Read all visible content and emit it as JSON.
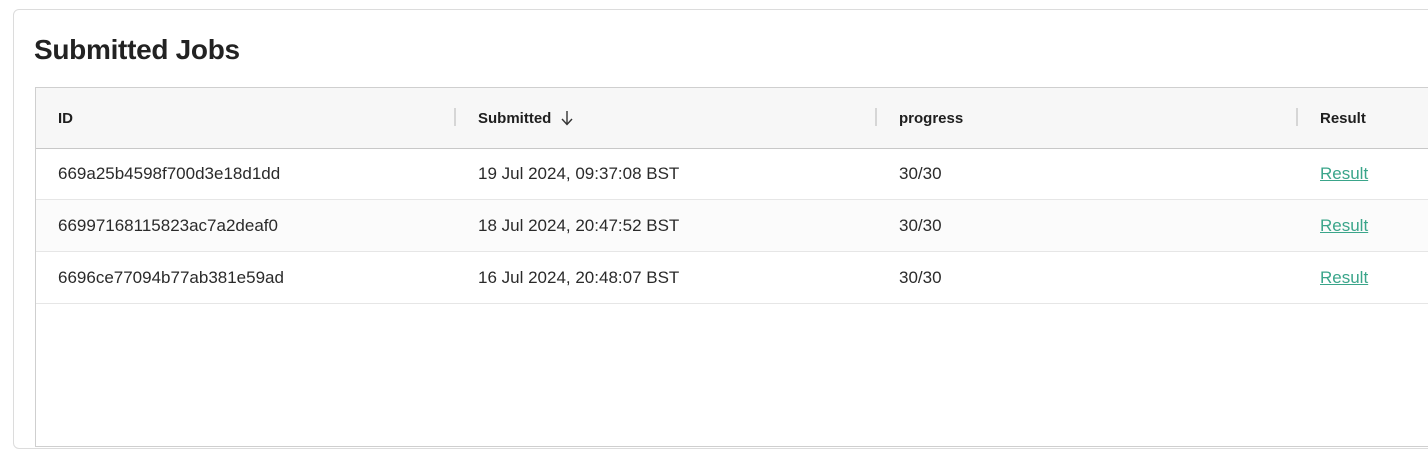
{
  "panel": {
    "title": "Submitted Jobs"
  },
  "table": {
    "columns": [
      {
        "label": "ID"
      },
      {
        "label": "Submitted",
        "sort": "descending",
        "sort_icon": "arrow-down-icon"
      },
      {
        "label": "progress"
      },
      {
        "label": "Result"
      }
    ],
    "rows": [
      {
        "id": "669a25b4598f700d3e18d1dd",
        "submitted": "19 Jul 2024, 09:37:08 BST",
        "progress": "30/30",
        "result": "Result"
      },
      {
        "id": "66997168115823ac7a2deaf0",
        "submitted": "18 Jul 2024, 20:47:52 BST",
        "progress": "30/30",
        "result": "Result"
      },
      {
        "id": "6696ce77094b77ab381e59ad",
        "submitted": "16 Jul 2024, 20:48:07 BST",
        "progress": "30/30",
        "result": "Result"
      }
    ]
  },
  "colors": {
    "link": "#3aa58a",
    "header_bg": "#f7f7f7",
    "border": "#cfcfcf"
  }
}
